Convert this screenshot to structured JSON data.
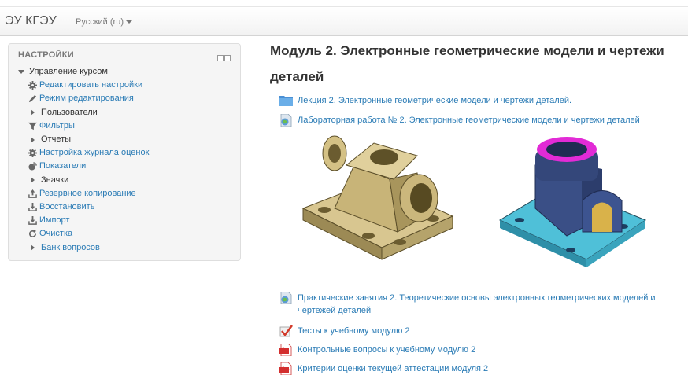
{
  "navbar": {
    "brand": "ЭУ КГЭУ",
    "language": "Русский (ru)"
  },
  "settings_block": {
    "title": "НАСТРОЙКИ",
    "course_admin": "Управление курсом",
    "items": [
      {
        "label": "Редактировать настройки",
        "icon": "gear-icon",
        "type": "link"
      },
      {
        "label": "Режим редактирования",
        "icon": "pencil-icon",
        "type": "link"
      },
      {
        "label": "Пользователи",
        "icon": "expand-icon",
        "type": "branch"
      },
      {
        "label": "Фильтры",
        "icon": "filter-icon",
        "type": "link"
      },
      {
        "label": "Отчеты",
        "icon": "expand-icon",
        "type": "branch"
      },
      {
        "label": "Настройка журнала оценок",
        "icon": "gear-icon",
        "type": "link"
      },
      {
        "label": "Показатели",
        "icon": "chart-icon",
        "type": "link"
      },
      {
        "label": "Значки",
        "icon": "expand-icon",
        "type": "branch"
      },
      {
        "label": "Резервное копирование",
        "icon": "upload-icon",
        "type": "link"
      },
      {
        "label": "Восстановить",
        "icon": "download-icon",
        "type": "link"
      },
      {
        "label": "Импорт",
        "icon": "download-icon",
        "type": "link"
      },
      {
        "label": "Очистка",
        "icon": "refresh-icon",
        "type": "link"
      },
      {
        "label": "Банк вопросов",
        "icon": "expand-icon",
        "type": "branch"
      }
    ]
  },
  "section": {
    "title": "Модуль 2. Электронные геометрические модели и чертежи деталей",
    "activities": [
      {
        "label": "Лекция 2. Электронные геометрические модели и чертежи деталей.",
        "icon": "folder-icon"
      },
      {
        "label": "Лабораторная работа № 2. Электронные геометрические модели и чертежи деталей",
        "icon": "page-icon"
      },
      {
        "label": "Практические занятия 2. Теоретические основы электронных геометрических моделей и чертежей деталей",
        "icon": "page-icon"
      },
      {
        "label": "Тесты к учебному модулю 2",
        "icon": "quiz-icon"
      },
      {
        "label": "Контрольные вопросы к учебному модулю 2",
        "icon": "pdf-icon"
      },
      {
        "label": "Критерии оценки текущей аттестации модуля 2",
        "icon": "pdf-icon"
      }
    ]
  },
  "colors": {
    "link": "#2a7bb5",
    "bronze": "#c9b27a",
    "blue_part": "#3a4f86",
    "cyan_base": "#4fc0d8",
    "magenta_ring": "#e22bd6"
  }
}
